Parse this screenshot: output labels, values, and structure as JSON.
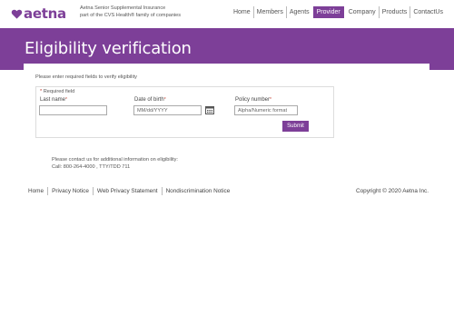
{
  "brand": {
    "name": "aetna",
    "tagline_line1": "Aetna Senior Supplemental Insurance",
    "tagline_line2": "part of the CVS Health® family of companies",
    "color": "#7d3f98"
  },
  "nav": {
    "items": [
      "Home",
      "Members",
      "Agents",
      "Provider",
      "Company",
      "Products",
      "ContactUs"
    ],
    "active": "Provider"
  },
  "page": {
    "title": "Eligibility verification",
    "intro": "Please enter required fields to verify eligibility"
  },
  "form": {
    "required_note": "Required field",
    "last_name_label": "Last name",
    "dob_label": "Date of birth",
    "dob_placeholder": "MM/dd/YYYY",
    "policy_label": "Policy number",
    "policy_placeholder": "Alpha/Numeric format",
    "submit_label": "Submit",
    "calendar_icon": "calendar-icon"
  },
  "contact": {
    "line1": "Please contact us for additional information on eligibility:",
    "line2": "Call:   800-264-4000 , TTY/TDD 711"
  },
  "footer": {
    "links": [
      "Home",
      "Privacy Notice",
      "Web Privacy Statement",
      "Nondiscrimination Notice"
    ],
    "copyright": "Copyright © 2020 Aetna Inc."
  }
}
